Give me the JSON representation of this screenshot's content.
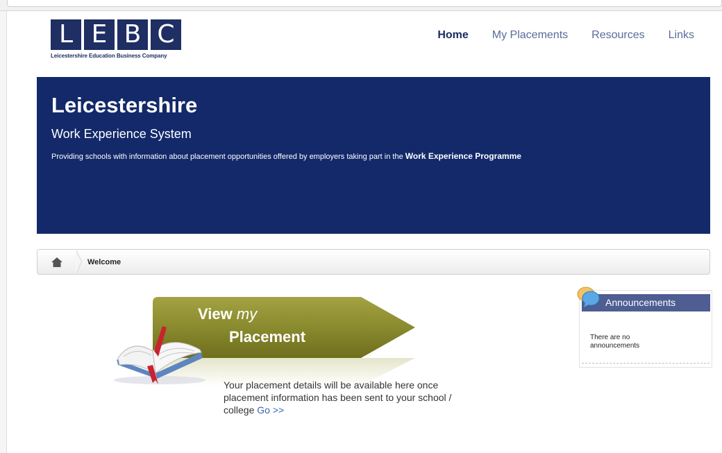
{
  "logo": {
    "letters": [
      "L",
      "E",
      "B",
      "C"
    ],
    "subtitle": "Leicestershire Education Business Company"
  },
  "nav": {
    "items": [
      {
        "label": "Home",
        "active": true
      },
      {
        "label": "My Placements",
        "active": false
      },
      {
        "label": "Resources",
        "active": false
      },
      {
        "label": "Links",
        "active": false
      }
    ]
  },
  "hero": {
    "title": "Leicestershire",
    "subtitle": "Work Experience System",
    "description": "Providing schools with information about placement opportunities offered by employers taking part in the",
    "description_bold": "Work Experience Programme"
  },
  "breadcrumb": {
    "current": "Welcome"
  },
  "promo": {
    "view_word": "View",
    "my_word": "my",
    "placement_word": "Placement",
    "description": "Your placement details will be available here once placement information has been sent to your school / college",
    "link_label": "Go >>"
  },
  "announcements": {
    "title": "Announcements",
    "empty_text": "There are no announcements"
  },
  "colors": {
    "brand_navy": "#13296a",
    "logo_navy": "#1f2e63",
    "nav_text": "#5b6b99",
    "olive": "#8a8a2e",
    "announcement_header": "#4e5d92"
  }
}
